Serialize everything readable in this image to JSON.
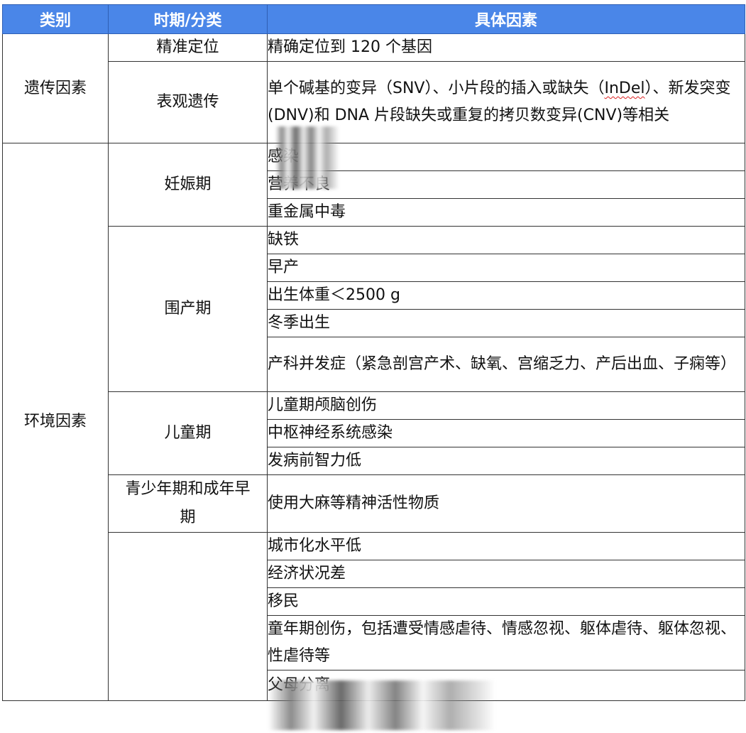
{
  "headers": {
    "category": "类别",
    "period": "时期/分类",
    "factors": "具体因素"
  },
  "genetic": {
    "category": "遗传因素",
    "rows": [
      {
        "period": "精准定位",
        "factors": [
          "精确定位到 120 个基因"
        ]
      },
      {
        "period": "表观遗传",
        "factors": [
          "单个碱基的变异（SNV）、小片段的插入或缺失（InDel）、新发突变(DNV)和 DNA 片段缺失或重复的拷贝数变异(CNV)等相关"
        ]
      }
    ]
  },
  "environment": {
    "category": "环境因素",
    "groups": [
      {
        "period": "妊娠期",
        "factors": [
          "感染",
          "营养不良",
          "重金属中毒"
        ]
      },
      {
        "period": "围产期",
        "factors": [
          "缺铁",
          "早产",
          "出生体重＜2500 g",
          "冬季出生",
          "产科并发症（紧急剖宫产术、缺氧、宫缩乏力、产后出血、子痫等）"
        ]
      },
      {
        "period": "儿童期",
        "factors": [
          "儿童期颅脑创伤",
          "中枢神经系统感染",
          "发病前智力低"
        ]
      },
      {
        "period": "青少年期和成年早期",
        "factors": [
          "使用大麻等精神活性物质"
        ]
      },
      {
        "period": "",
        "factors": [
          "城市化水平低",
          "经济状况差",
          "移民",
          "童年期创伤，包括遭受情感虐待、情感忽视、躯体虐待、躯体忽视、性虐待等",
          "父母分离"
        ]
      }
    ]
  },
  "indel_label": "InDel"
}
